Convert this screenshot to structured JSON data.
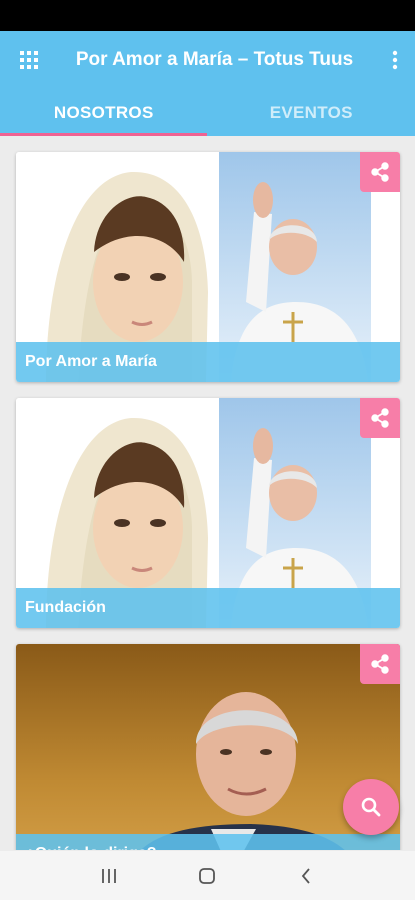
{
  "app": {
    "title": "Por Amor a María – Totus Tuus",
    "accent_color": "#5fc1ee",
    "pink_color": "#f77ea8"
  },
  "tabs": [
    {
      "label": "NOSOTROS",
      "active": true
    },
    {
      "label": "EVENTOS",
      "active": false
    }
  ],
  "cards": [
    {
      "caption": "Por Amor a María",
      "image": "virgin-mary-and-pope-photo"
    },
    {
      "caption": "Fundación",
      "image": "virgin-mary-and-pope-photo"
    },
    {
      "caption": "¿Quién lo dirige?",
      "image": "director-portrait-photo"
    }
  ],
  "icons": {
    "app_menu": "grid-icon",
    "overflow": "more-vert-icon",
    "share": "share-icon",
    "fab": "search-icon"
  }
}
